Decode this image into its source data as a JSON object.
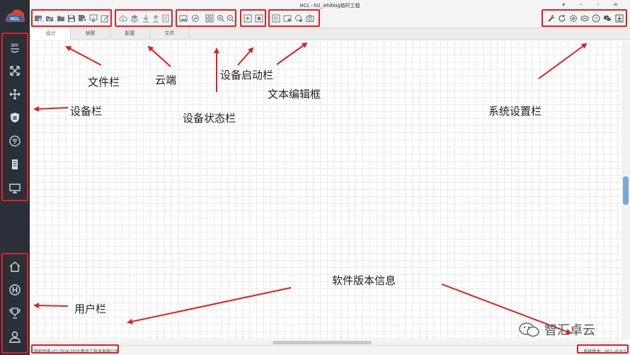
{
  "window": {
    "title": "HCL - hcl_ieh8loig临时工程",
    "controls": "▾ – ▫ ✕"
  },
  "app_logo": "HCL",
  "tabs": [
    {
      "label": "设计",
      "active": true
    },
    {
      "label": "帧聚",
      "active": false
    },
    {
      "label": "配置",
      "active": false
    },
    {
      "label": "文件",
      "active": false
    }
  ],
  "sidebar": {
    "device_icons": [
      "diy-icon",
      "router-icon",
      "switch-icon",
      "firewall-icon",
      "wireless-icon",
      "server-icon",
      "terminal-icon"
    ],
    "user_icons": [
      "home-icon",
      "h3c-icon",
      "trophy-icon",
      "user-icon"
    ]
  },
  "toolbar": {
    "file_icons": [
      "new-project-icon",
      "open-icon",
      "folder-icon",
      "save-icon",
      "save-as-icon",
      "export-icon",
      "edit-icon"
    ],
    "cloud_icons": [
      "cloud-icon",
      "layers-icon",
      "download-icon",
      "upload-icon",
      "document-icon"
    ],
    "status_icons": [
      "image-icon",
      "chart-icon",
      "grid-icon",
      "zoom-in-icon",
      "zoom-out-icon"
    ],
    "start_icons": [
      "play-icon",
      "stop-icon"
    ],
    "text_icons": [
      "text-box-icon",
      "screen-icon",
      "message-icon",
      "camera-icon"
    ],
    "system_icons": [
      "wrench-icon",
      "refresh-icon",
      "settings-icon",
      "network-icon",
      "help-icon",
      "wechat-icon",
      "download-box-icon"
    ]
  },
  "status": {
    "copyright": "版权所有 (C) 2014-2023 新华三技术有限公司",
    "version": "系统版本：HCL v5.8.0"
  },
  "annotations": {
    "file_bar": "文件栏",
    "cloud": "云端",
    "device_start_bar": "设备启动栏",
    "text_edit_box": "文本编辑框",
    "device_bar": "设备栏",
    "device_status_bar": "设备状态栏",
    "system_settings_bar": "系统设置栏",
    "user_bar": "用户栏",
    "software_version": "软件版本信息"
  },
  "watermark": "智汇卓云",
  "colors": {
    "sidebar_bg": "#2b2f38",
    "annotation_red": "#e02020",
    "accent_blue": "#7aa7d8"
  }
}
